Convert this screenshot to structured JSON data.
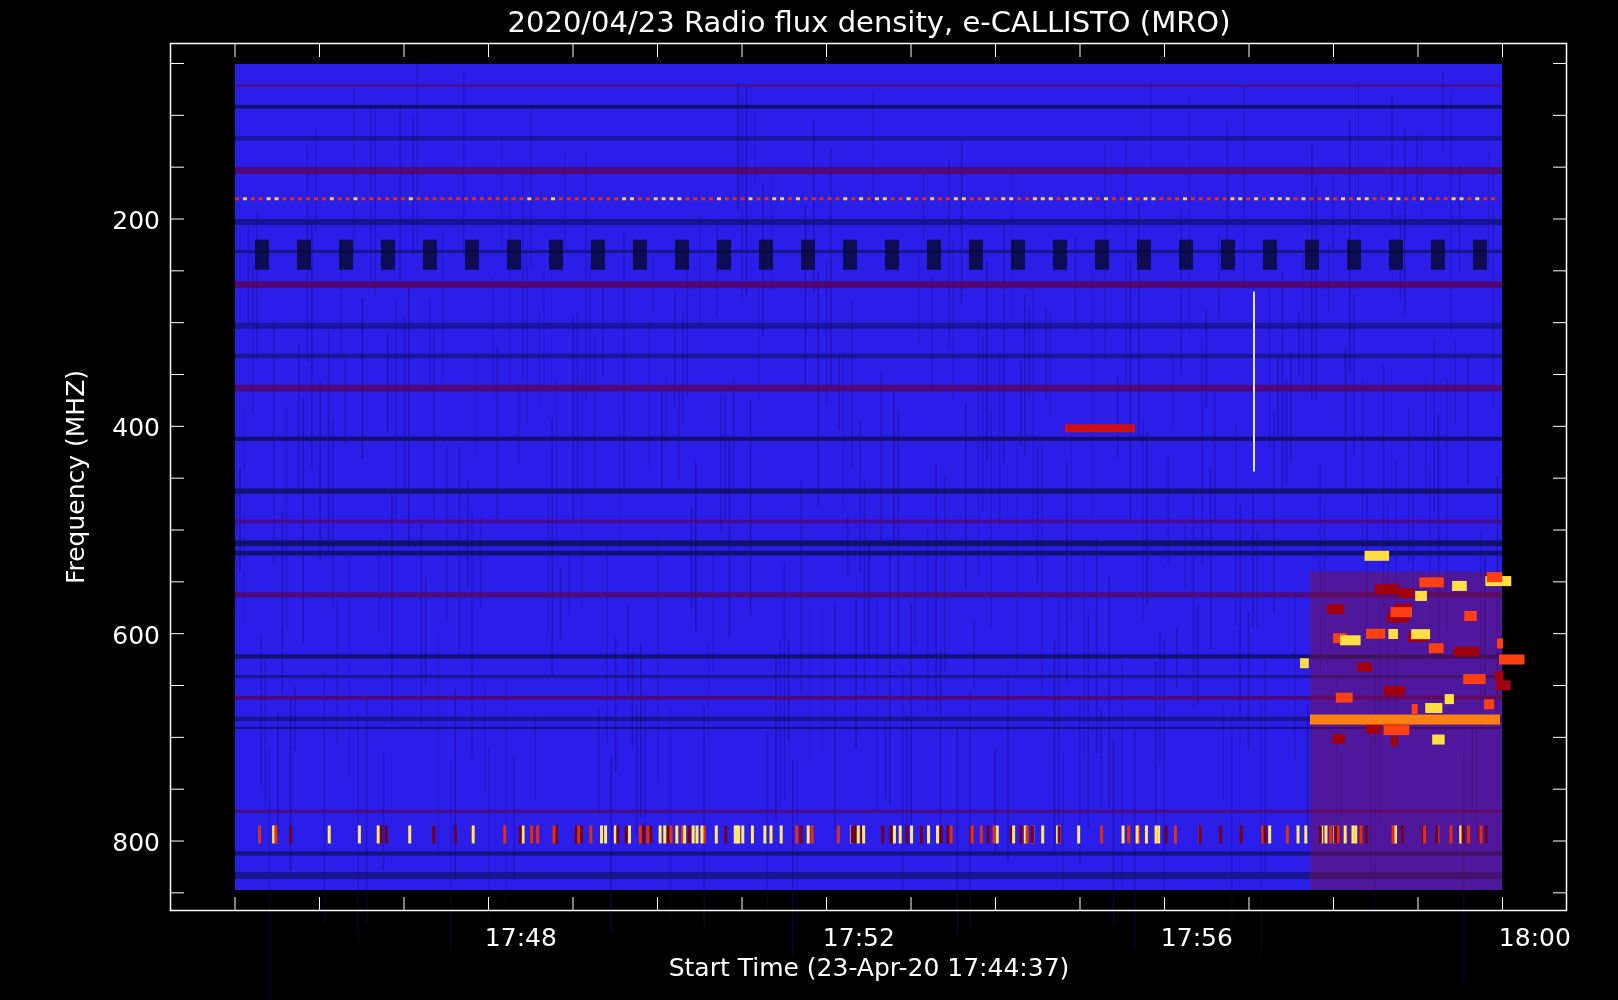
{
  "title": "2020/04/23  Radio flux density, e-CALLISTO (MRO)",
  "y_axis": {
    "label": "Frequency (MHZ)",
    "ticks": [
      "200",
      "400",
      "600",
      "800"
    ]
  },
  "x_axis": {
    "label": "Start Time (23-Apr-20 17:44:37)",
    "ticks": [
      "17:48",
      "17:52",
      "17:56",
      "18:00"
    ]
  }
}
